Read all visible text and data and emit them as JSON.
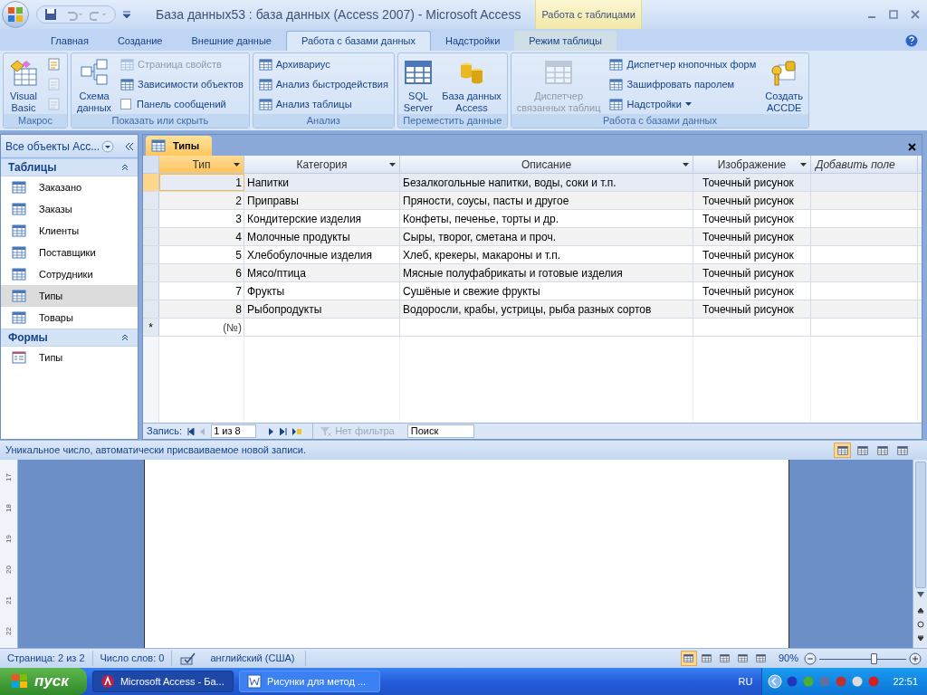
{
  "window": {
    "title": "База данных53 : база данных (Access 2007) - Microsoft Access",
    "context_tab": "Работа с таблицами"
  },
  "ribbon_tabs": [
    {
      "label": "Главная",
      "selected": false,
      "context": false
    },
    {
      "label": "Создание",
      "selected": false,
      "context": false
    },
    {
      "label": "Внешние данные",
      "selected": false,
      "context": false
    },
    {
      "label": "Работа с базами данных",
      "selected": true,
      "context": false
    },
    {
      "label": "Надстройки",
      "selected": false,
      "context": false
    },
    {
      "label": "Режим таблицы",
      "selected": false,
      "context": true
    }
  ],
  "ribbon_groups": [
    {
      "title": "Макрос",
      "columns": [
        [
          {
            "kind": "large",
            "lines": [
              "Visual",
              "Basic"
            ],
            "disabled": false
          }
        ],
        [
          {
            "kind": "icon",
            "disabled": false
          },
          {
            "kind": "icon",
            "disabled": true
          },
          {
            "kind": "icon",
            "disabled": true
          }
        ]
      ]
    },
    {
      "title": "Показать или скрыть",
      "columns": [
        [
          {
            "kind": "large",
            "lines": [
              "Схема",
              "данных"
            ],
            "disabled": false
          }
        ],
        [
          {
            "kind": "small",
            "label": "Страница свойств",
            "disabled": true
          },
          {
            "kind": "small",
            "label": "Зависимости объектов",
            "disabled": false
          },
          {
            "kind": "checkbox",
            "label": "Панель сообщений",
            "checked": false
          }
        ]
      ]
    },
    {
      "title": "Анализ",
      "columns": [
        [
          {
            "kind": "small",
            "label": "Архивариус",
            "disabled": false
          },
          {
            "kind": "small",
            "label": "Анализ быстродействия",
            "disabled": false
          },
          {
            "kind": "small",
            "label": "Анализ таблицы",
            "disabled": false
          }
        ]
      ]
    },
    {
      "title": "Переместить данные",
      "columns": [
        [
          {
            "kind": "large",
            "lines": [
              "SQL",
              "Server"
            ],
            "disabled": false
          }
        ],
        [
          {
            "kind": "large",
            "lines": [
              "База данных",
              "Access"
            ],
            "disabled": false
          }
        ]
      ]
    },
    {
      "title": "Работа с базами данных",
      "columns": [
        [
          {
            "kind": "large",
            "lines": [
              "Диспетчер",
              "связанных таблиц"
            ],
            "disabled": true
          }
        ],
        [
          {
            "kind": "small",
            "label": "Диспетчер кнопочных форм",
            "disabled": false
          },
          {
            "kind": "small",
            "label": "Зашифровать паролем",
            "disabled": false
          },
          {
            "kind": "small",
            "label": "Надстройки",
            "disabled": false,
            "dropdown": true
          }
        ],
        [
          {
            "kind": "large",
            "lines": [
              "Создать",
              "ACCDE"
            ],
            "disabled": false
          }
        ]
      ]
    }
  ],
  "navigation": {
    "header": "Все объекты Асс...",
    "sections": [
      {
        "title": "Таблицы",
        "kind": "table",
        "items": [
          {
            "label": "Заказано",
            "selected": false
          },
          {
            "label": "Заказы",
            "selected": false
          },
          {
            "label": "Клиенты",
            "selected": false
          },
          {
            "label": "Поставщики",
            "selected": false
          },
          {
            "label": "Сотрудники",
            "selected": false
          },
          {
            "label": "Типы",
            "selected": true
          },
          {
            "label": "Товары",
            "selected": false
          }
        ]
      },
      {
        "title": "Формы",
        "kind": "form",
        "items": [
          {
            "label": "Типы",
            "selected": false
          }
        ]
      }
    ]
  },
  "document_tab": "Типы",
  "table": {
    "columns": [
      {
        "label": "Тип",
        "kind": "field",
        "selected": true
      },
      {
        "label": "Категория",
        "kind": "field",
        "selected": false
      },
      {
        "label": "Описание",
        "kind": "field",
        "selected": false
      },
      {
        "label": "Изображение",
        "kind": "field",
        "selected": false
      },
      {
        "label": "Добавить поле",
        "kind": "add",
        "selected": false
      }
    ],
    "rows": [
      {
        "selected": true,
        "cells": [
          "1",
          "Напитки",
          "Безалкогольные напитки, воды, соки и т.п.",
          "Точечный рисунок"
        ]
      },
      {
        "selected": false,
        "cells": [
          "2",
          "Приправы",
          "Пряности, соусы, пасты и другое",
          "Точечный рисунок"
        ]
      },
      {
        "selected": false,
        "cells": [
          "3",
          "Кондитерские изделия",
          "Конфеты, печенье, торты и др.",
          "Точечный рисунок"
        ]
      },
      {
        "selected": false,
        "cells": [
          "4",
          "Молочные продукты",
          "Сыры, творог, сметана и проч.",
          "Точечный рисунок"
        ]
      },
      {
        "selected": false,
        "cells": [
          "5",
          "Хлебобулочные изделия",
          "Хлеб, крекеры, макароны и т.п.",
          "Точечный рисунок"
        ]
      },
      {
        "selected": false,
        "cells": [
          "6",
          "Мясо/птица",
          "Мясные полуфабрикаты и готовые изделия",
          "Точечный рисунок"
        ]
      },
      {
        "selected": false,
        "cells": [
          "7",
          "Фрукты",
          "Сушёные и свежие фрукты",
          "Точечный рисунок"
        ]
      },
      {
        "selected": false,
        "cells": [
          "8",
          "Рыбопродукты",
          "Водоросли, крабы, устрицы, рыба разных сортов",
          "Точечный рисунок"
        ]
      }
    ],
    "new_row_marker": "*",
    "new_row_value": "(№)"
  },
  "record_nav": {
    "label": "Запись:",
    "position": "1 из 8",
    "filter": "Нет фильтра",
    "search": "Поиск"
  },
  "status_bar": "Уникальное число, автоматически присваиваемое новой записи.",
  "word": {
    "ruler": [
      "17",
      "18",
      "19",
      "20",
      "21",
      "22"
    ],
    "status": [
      "Страница: 2 из 2",
      "Число слов: 0",
      "английский (США)"
    ],
    "zoom": "90%",
    "zoom_slider": {
      "level": 0.62
    }
  },
  "taskbar": {
    "start": "пуск",
    "tasks": [
      {
        "label": "Microsoft Access - Ба...",
        "selected": true
      },
      {
        "label": "Рисунки для метод ...",
        "selected": false
      }
    ],
    "language": "RU",
    "time": "22:51"
  }
}
